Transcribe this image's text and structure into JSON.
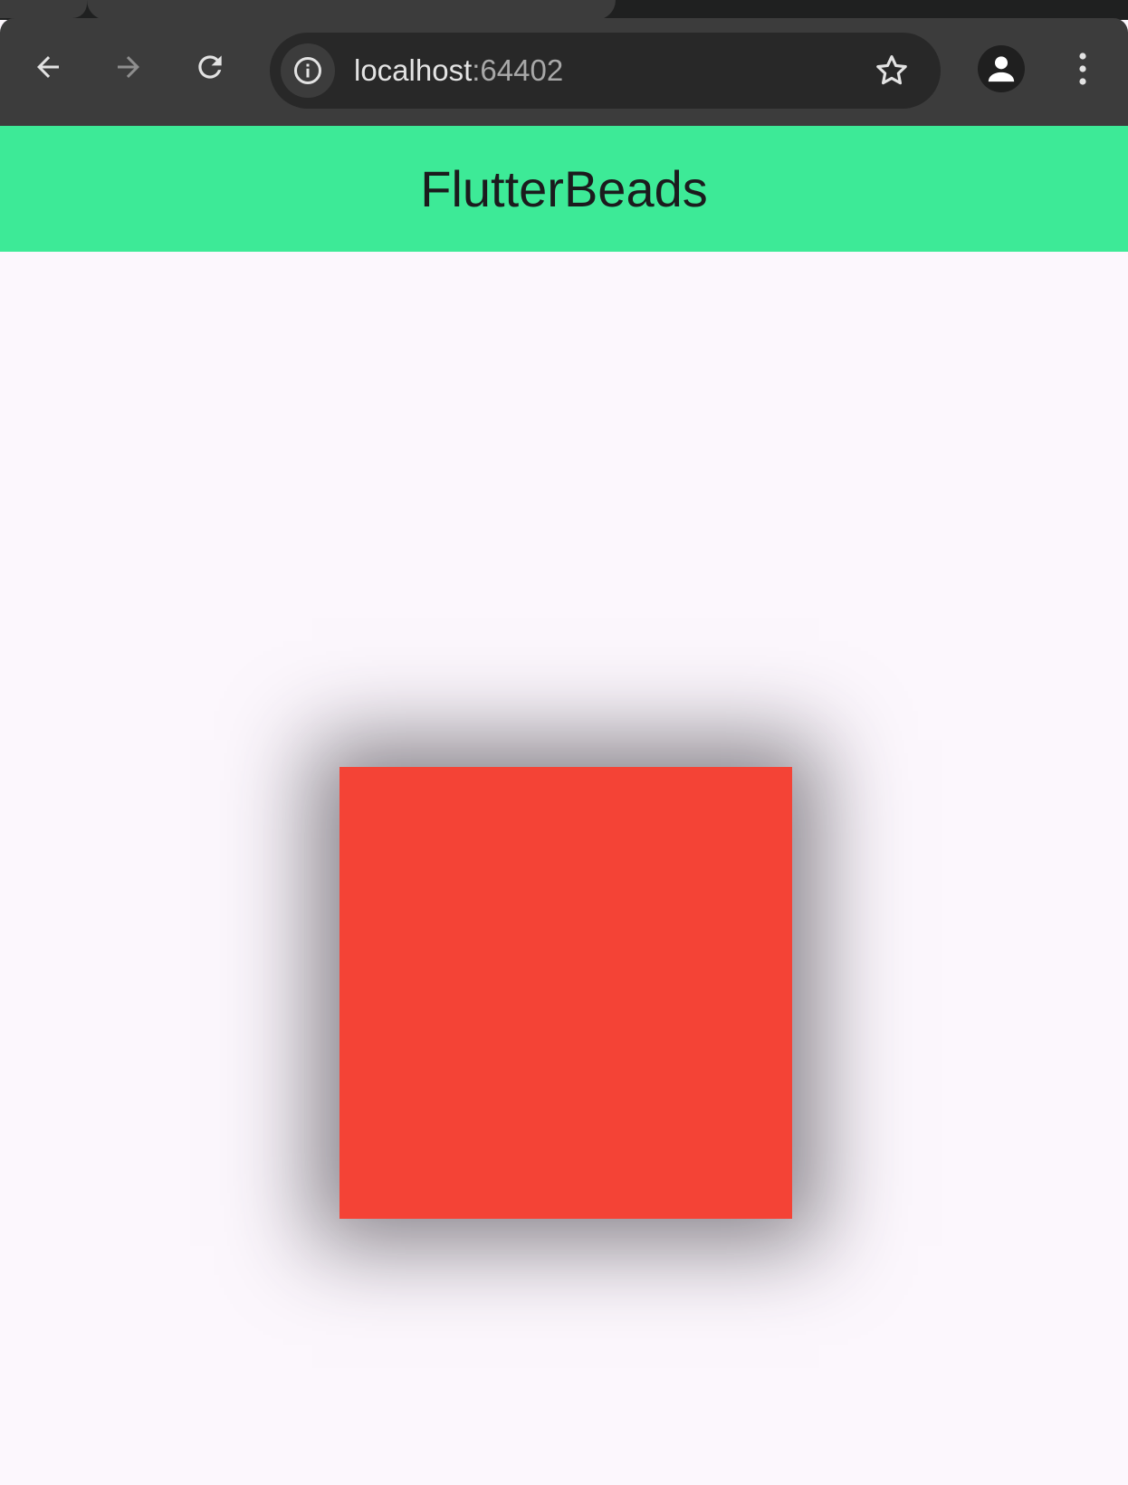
{
  "browser": {
    "address": {
      "host": "localhost",
      "port": ":64402"
    },
    "icons": {
      "back": "arrow-left-icon",
      "forward": "arrow-right-icon",
      "reload": "reload-icon",
      "site_info": "info-icon",
      "bookmark": "star-icon",
      "profile": "person-icon",
      "menu": "more-vertical-icon"
    },
    "colors": {
      "toolbar": "#3c3c3c",
      "omnibox": "#282828",
      "tabstrip": "#1f2020"
    }
  },
  "app": {
    "title": "FlutterBeads",
    "colors": {
      "appbar": "#3dea97",
      "background": "#fcf7fd",
      "box": "#f44336",
      "shadow": "#28242c"
    }
  }
}
